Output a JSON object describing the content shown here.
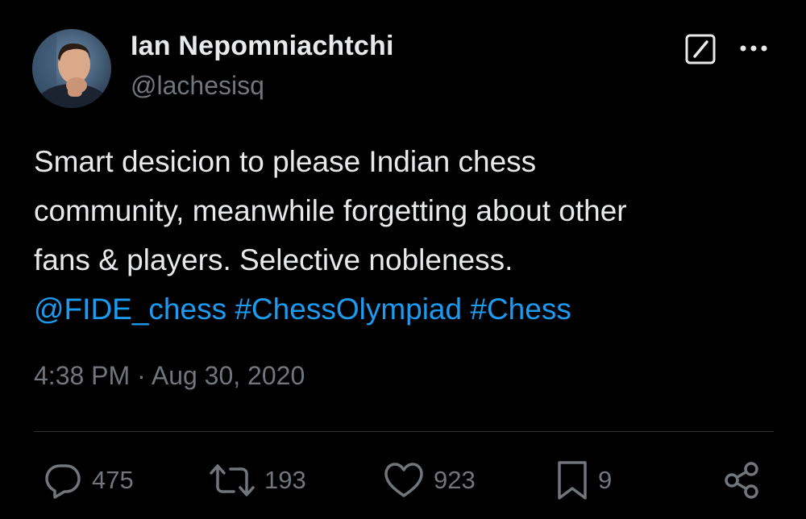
{
  "author": {
    "display_name": "Ian Nepomniachtchi",
    "handle": "@lachesisq"
  },
  "header_icons": {
    "grok": "grok-icon",
    "more": "more-icon"
  },
  "tweet": {
    "line1": "Smart desicion to please Indian chess",
    "line2": "community, meanwhile forgetting about other",
    "line3": "fans & players. Selective nobleness.",
    "mention": "@FIDE_chess",
    "hashtag1": "#ChessOlympiad",
    "hashtag2": "#Chess",
    "timestamp": "4:38 PM · Aug 30, 2020"
  },
  "actions": {
    "replies": "475",
    "reposts": "193",
    "likes": "923",
    "bookmarks": "9"
  },
  "colors": {
    "background": "#000000",
    "text": "#e7e9ea",
    "muted": "#71767b",
    "link": "#1d9bf0",
    "divider": "#2f3336"
  }
}
